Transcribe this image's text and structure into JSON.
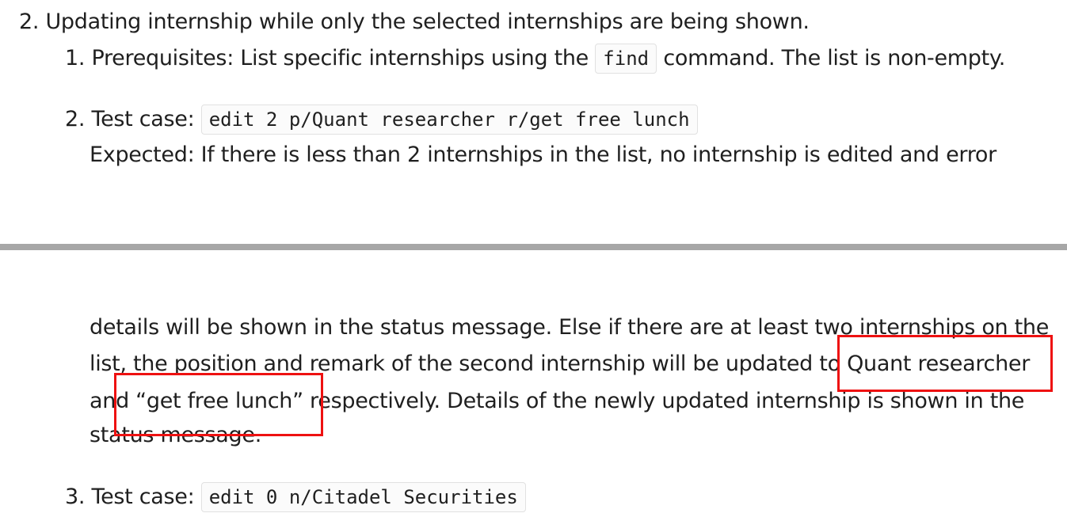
{
  "item2": {
    "number": "2.",
    "text": "Updating internship while only the selected internships are being shown."
  },
  "sub1": {
    "number": "1.",
    "text_before": "Prerequisites: List specific internships using the",
    "code": "find",
    "text_after": "command. The list is non-empty."
  },
  "sub2": {
    "number": "2.",
    "label": "Test case:",
    "code": "edit 2 p/Quant researcher r/get free lunch",
    "expected_line1": "Expected: If there is less than 2 internships in the list, no internship is edited and error",
    "line2": "details will be shown in the status message. Else if there are at least two internships on the",
    "line3_a": "list, the position and remark of the second internship will be updated t",
    "line3_b": "o Quant researcher",
    "line4_a": "an",
    "line4_b": "d “get free lunch” r",
    "line4_c": "espectively. Details of the newly updated internship is shown in the",
    "line5_a": "sta",
    "line5_b": "tus message."
  },
  "sub3": {
    "number": "3.",
    "label": "Test case:",
    "code": "edit 0 n/Citadel Securities"
  },
  "annotations": {
    "color": "#ee1111"
  }
}
